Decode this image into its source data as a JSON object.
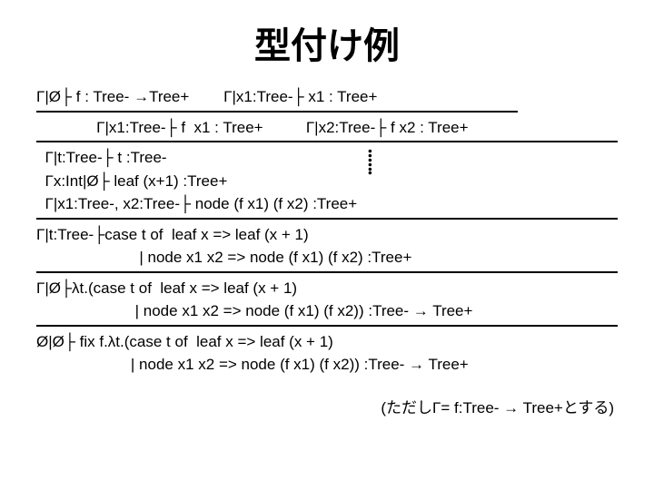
{
  "title": "型付け例",
  "lines": {
    "l1a": "Γ|Ø├ f : Tree- →Tree+",
    "l1b": "Γ|x1:Tree-├ x1 : Tree+",
    "l2a": "Γ|x1:Tree-├ f  x1 : Tree+",
    "l2b": "Γ|x2:Tree-├ f x2 : Tree+",
    "l3a": "Γ|t:Tree-├ t :Tree-",
    "l3b": "Γx:Int|Ø├ leaf (x+1) :Tree+",
    "l3c": "Γ|x1:Tree-, x2:Tree-├ node (f x1) (f x2) :Tree+",
    "l4a": "Γ|t:Tree-├case t of  leaf x => leaf (x + 1)",
    "l4b": "                        | node x1 x2 => node (f x1) (f x2) :Tree+",
    "l5a": "Γ|Ø├λt.(case t of  leaf x => leaf (x + 1)",
    "l5b": "                       | node x1 x2 => node (f x1) (f x2)) :Tree- → Tree+",
    "l6a": "Ø|Ø├ fix f.λt.(case t of  leaf x => leaf (x + 1)",
    "l6b": "                      | node x1 x2 => node (f x1) (f x2)) :Tree- → Tree+",
    "footnote": "(ただしΓ= f:Tree- → Tree+とする)"
  }
}
